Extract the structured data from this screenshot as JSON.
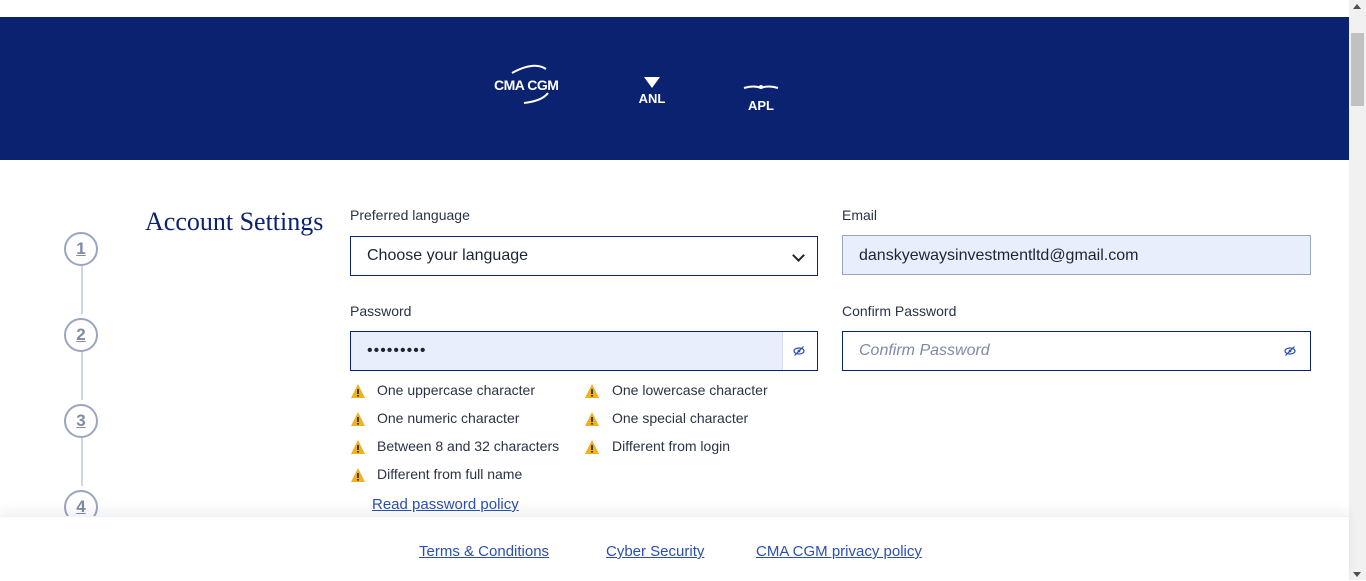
{
  "banner": {
    "brands": [
      "CMA CGM",
      "ANL",
      "APL"
    ],
    "background_color": "#0a2270"
  },
  "stepper": {
    "steps": [
      "1",
      "2",
      "3",
      "4"
    ]
  },
  "section": {
    "title": "Account Settings"
  },
  "form": {
    "language": {
      "label": "Preferred language",
      "value": "Choose your language",
      "icon": "chevron-down-icon"
    },
    "email": {
      "label": "Email",
      "value": "danskyewaysinvestmentltd@gmail.com"
    },
    "password": {
      "label": "Password",
      "value": "•••••••••",
      "icon": "eye-off-icon"
    },
    "confirm_password": {
      "label": "Confirm Password",
      "placeholder": "Confirm Password",
      "icon": "eye-off-icon"
    }
  },
  "password_rules": [
    "One uppercase character",
    "One lowercase character",
    "One numeric character",
    "One special character",
    "Between 8 and 32 characters",
    "Different from login",
    "Different from full name"
  ],
  "rule_icon": "warning-icon",
  "warning_color": "#f2b01e",
  "policy_link": "Read password policy",
  "footer": {
    "links": [
      "Terms & Conditions",
      "Cyber Security",
      "CMA CGM privacy policy"
    ]
  },
  "accent_color": "#2a4fb3"
}
